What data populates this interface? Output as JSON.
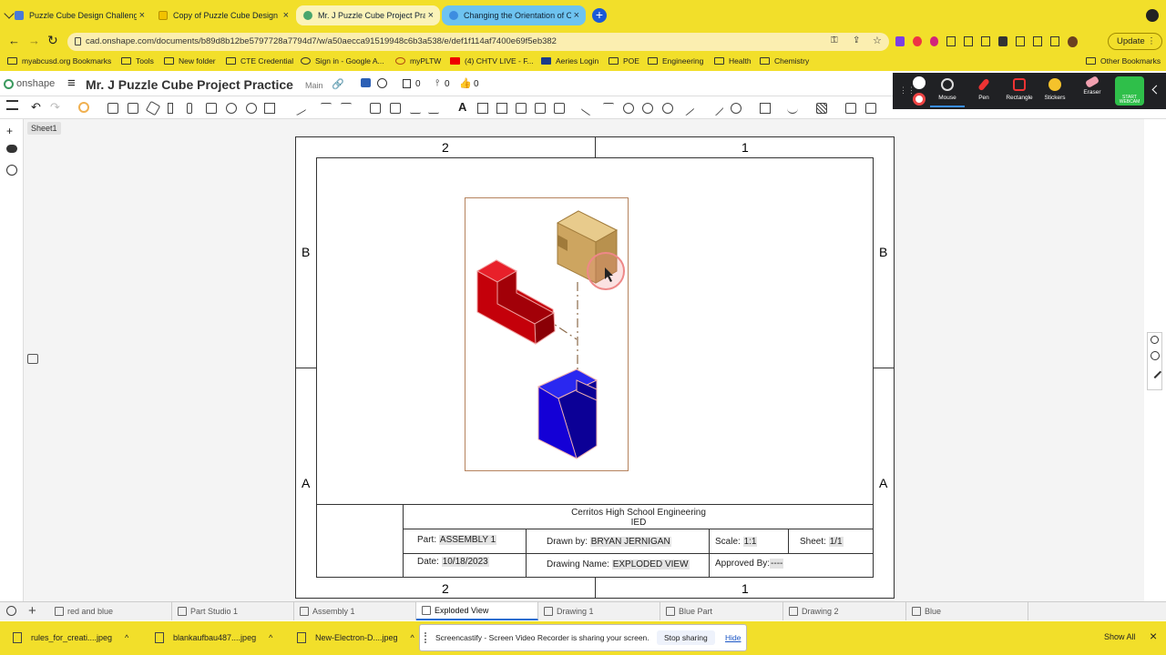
{
  "browser_tabs": [
    {
      "title": "Puzzle Cube Design Challenge",
      "color": "#4a7ad8"
    },
    {
      "title": "Copy of Puzzle Cube Design C",
      "color": "#f2c200"
    },
    {
      "title": "Mr. J Puzzle Cube Project Prac",
      "color": "#49a56d"
    },
    {
      "title": "Changing the Orientation of O",
      "color": "#3d8de0"
    }
  ],
  "url": "cad.onshape.com/documents/b89d8b12be5797728a7794d7/w/a50aecca91519948c6b3a538/e/def1f114af7400e69f5eb382",
  "update_label": "Update",
  "bookmarks": [
    "myabcusd.org Bookmarks",
    "Tools",
    "New folder",
    "CTE Credential",
    "Sign in - Google A...",
    "myPLTW",
    "(4) CHTV LIVE - F...",
    "Aeries Login",
    "POE",
    "Engineering",
    "Health",
    "Chemistry"
  ],
  "other_bookmarks": "Other Bookmarks",
  "onshape": {
    "logo": "onshape",
    "doc_title": "Mr. J Puzzle Cube Project Practice",
    "branch": "Main",
    "count1": "0",
    "count2": "0",
    "count3": "0"
  },
  "sheet_tab": "Sheet1",
  "screcorder": {
    "tools": [
      "Mouse",
      "Pen",
      "Rectangle",
      "Stickers",
      "Eraser"
    ],
    "webcam": "START WEBCAM"
  },
  "drawing": {
    "zones_top": [
      "2",
      "1"
    ],
    "zones_bottom": [
      "2",
      "1"
    ],
    "zones_left": [
      "B",
      "A"
    ],
    "zones_right": [
      "B",
      "A"
    ],
    "title_block": {
      "school": "Cerritos High School Engineering",
      "course": "IED",
      "part_label": "Part:",
      "part": "ASSEMBLY 1",
      "drawn_label": "Drawn by:",
      "drawn": "BRYAN JERNIGAN",
      "scale_label": "Scale:",
      "scale": "1:1",
      "sheet_label": "Sheet:",
      "sheet": "1/1",
      "date_label": "Date:",
      "date": "10/18/2023",
      "dname_label": "Drawing Name:",
      "dname": "EXPLODED VIEW",
      "approved_label": "Approved By:",
      "approved": "----"
    }
  },
  "bottom_tabs": [
    "red and blue",
    "Part Studio 1",
    "Assembly 1",
    "Exploded View",
    "Drawing 1",
    "Blue Part",
    "Drawing 2",
    "Blue"
  ],
  "downloads": [
    "rules_for_creati....jpeg",
    "blankaufbau487....jpeg",
    "New-Electron-D....jpeg"
  ],
  "share_notice": {
    "text": "Screencastify - Screen Video Recorder is sharing your screen.",
    "stop": "Stop sharing",
    "hide": "Hide"
  },
  "show_all": "Show All",
  "colors": {
    "chrome_yellow": "#f2df2a",
    "red_part": "#c4000a",
    "blue_part": "#1400d6",
    "tan_part": "#d7b671",
    "frame_border": "#b5825d"
  }
}
